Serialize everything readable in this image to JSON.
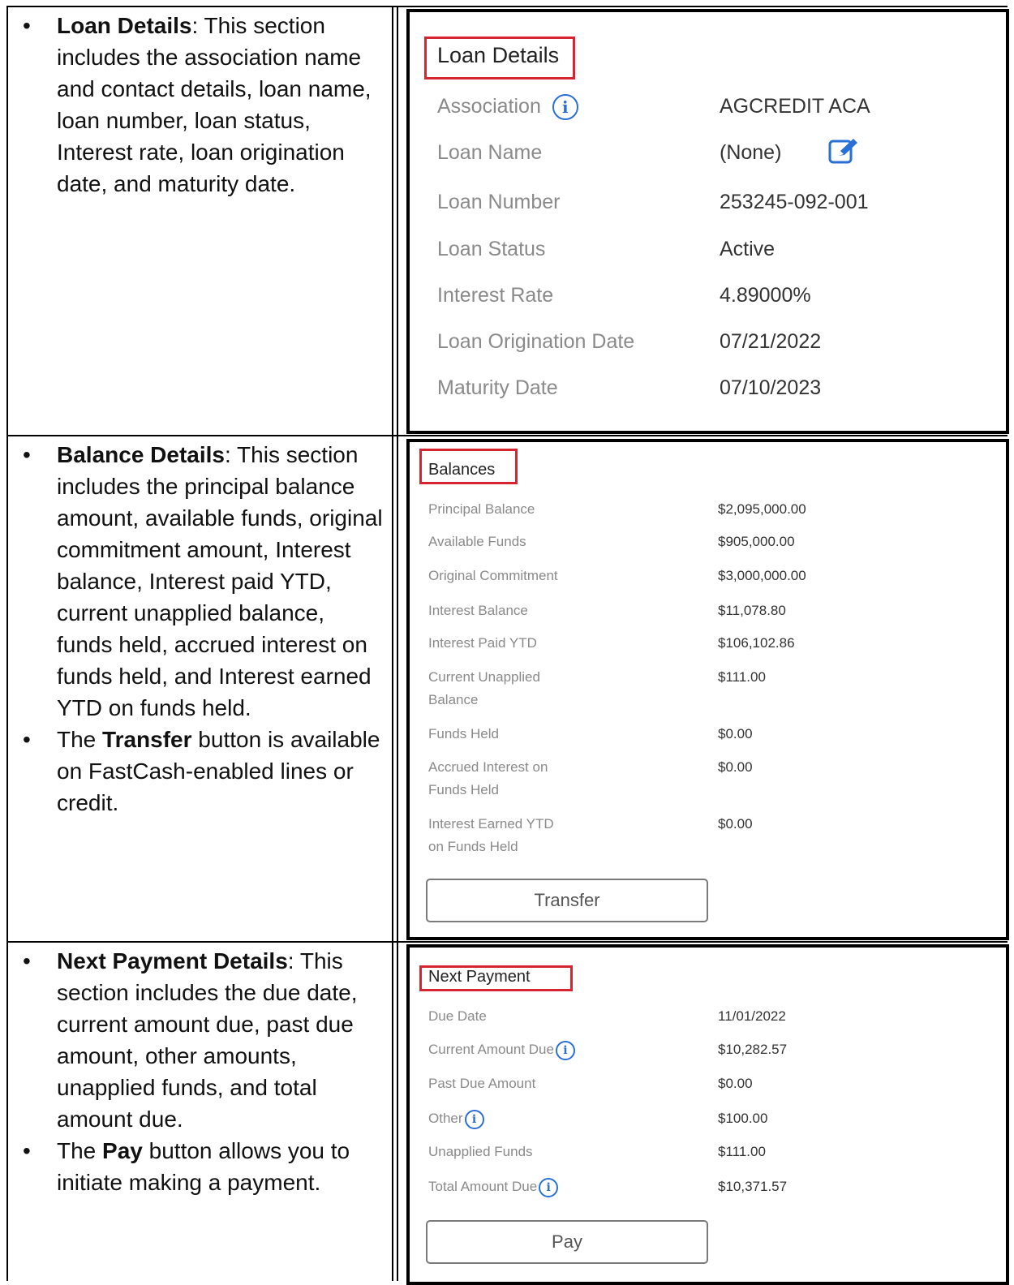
{
  "rows": [
    {
      "bullets": [
        {
          "bold": "Loan Details",
          "text": ": This section includes the association name and contact details, loan name, loan number, loan status, Interest rate, loan origination date, and maturity date."
        }
      ]
    },
    {
      "bullets": [
        {
          "bold": "Balance Details",
          "text": ": This section includes the principal balance amount, available funds, original commitment amount, Interest balance, Interest paid YTD, current unapplied balance, funds held, accrued interest on funds held, and Interest earned YTD on funds held."
        },
        {
          "pre": "The ",
          "bold": "Transfer",
          "text": " button is available on FastCash-enabled lines or credit."
        }
      ]
    },
    {
      "bullets": [
        {
          "bold": "Next Payment Details",
          "text": ": This section includes the due date, current amount due, past due amount, other amounts, unapplied funds, and total amount due."
        },
        {
          "pre": "The ",
          "bold": "Pay",
          "text": " button allows you to initiate making a payment."
        }
      ]
    }
  ],
  "loan": {
    "title": "Loan Details",
    "fields": [
      {
        "label": "Association",
        "value": "AGCREDIT ACA",
        "icon": "info-icon"
      },
      {
        "label": "Loan Name",
        "value": "(None)",
        "icon": "edit-icon"
      },
      {
        "label": "Loan Number",
        "value": "253245-092-001"
      },
      {
        "label": "Loan Status",
        "value": "Active"
      },
      {
        "label": "Interest Rate",
        "value": "4.89000%"
      },
      {
        "label": "Loan Origination Date",
        "value": "07/21/2022"
      },
      {
        "label": "Maturity Date",
        "value": "07/10/2023"
      }
    ]
  },
  "balances": {
    "title": "Balances",
    "fields": [
      {
        "label": "Principal Balance",
        "value": "$2,095,000.00"
      },
      {
        "label": "Available Funds",
        "value": "$905,000.00"
      },
      {
        "label": "Original Commitment",
        "value": "$3,000,000.00"
      },
      {
        "label": "Interest Balance",
        "value": "$11,078.80"
      },
      {
        "label": "Interest Paid YTD",
        "value": "$106,102.86"
      },
      {
        "label": "Current Unapplied",
        "label2": "Balance",
        "value": "$111.00"
      },
      {
        "label": "Funds Held",
        "value": "$0.00"
      },
      {
        "label": "Accrued Interest on",
        "label2": "Funds Held",
        "value": "$0.00"
      },
      {
        "label": "Interest Earned YTD",
        "label2": "on Funds Held",
        "value": "$0.00"
      }
    ],
    "button": "Transfer"
  },
  "payment": {
    "title": "Next Payment",
    "fields": [
      {
        "label": "Due Date",
        "value": "11/01/2022"
      },
      {
        "label": "Current Amount Due",
        "value": "$10,282.57",
        "icon": "info-icon"
      },
      {
        "label": "Past Due Amount",
        "value": "$0.00"
      },
      {
        "label": "Other",
        "value": "$100.00",
        "icon": "info-icon"
      },
      {
        "label": "Unapplied Funds",
        "value": "$111.00"
      },
      {
        "label": "Total Amount Due",
        "value": "$10,371.57",
        "icon": "info-icon"
      }
    ],
    "button": "Pay"
  },
  "colors": {
    "highlight": "#d62430",
    "info": "#2a6fd6"
  }
}
